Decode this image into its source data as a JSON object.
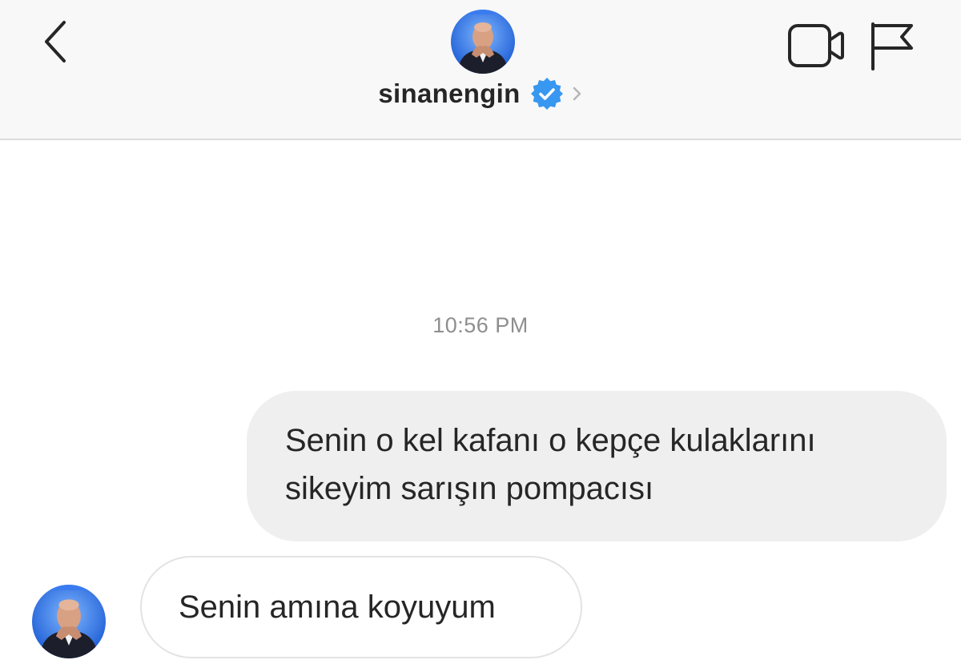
{
  "header": {
    "username": "sinanengin",
    "verified": true,
    "icons": {
      "back": "chevron-left-icon",
      "verified": "verified-badge-icon",
      "profile_chevron": "chevron-right-icon",
      "video": "video-camera-icon",
      "flag": "flag-icon"
    }
  },
  "conversation": {
    "timestamp": "10:56 PM",
    "messages": [
      {
        "direction": "outgoing",
        "lines": [
          "Senin o kel kafanı o kepçe kulaklarını",
          "sikeyim sarışın pompacısı"
        ]
      },
      {
        "direction": "incoming",
        "text": "Senin amına koyuyum"
      }
    ]
  },
  "colors": {
    "header_bg": "#f8f8f8",
    "verified_blue": "#3897f0",
    "outgoing_bubble": "#efefef",
    "text": "#262626",
    "timestamp": "#8e8e8e"
  }
}
